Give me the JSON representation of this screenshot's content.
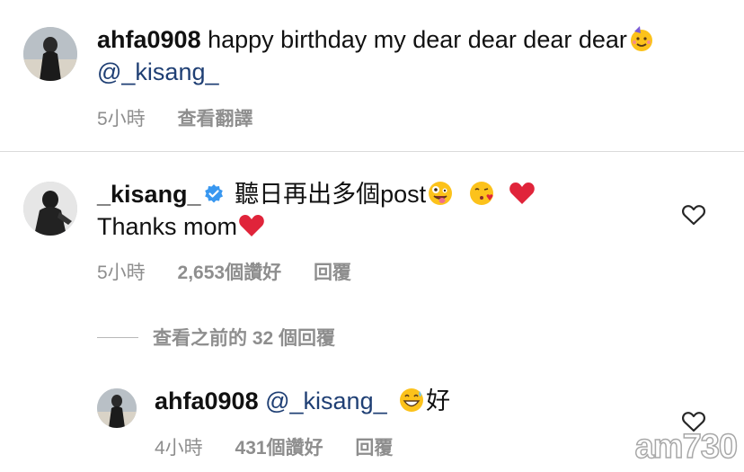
{
  "comment1": {
    "username": "ahfa0908",
    "text": "happy birthday my dear dear dear dear",
    "mention": "@_kisang_",
    "time": "5小時",
    "translate_label": "查看翻譯",
    "emoji": "partying-face"
  },
  "comment2": {
    "username": "_kisang_",
    "verified": true,
    "text_line1": "聽日再出多個post",
    "text_line2": "Thanks mom",
    "time": "5小時",
    "likes": "2,653個讚好",
    "reply_label": "回覆"
  },
  "view_replies": {
    "label": "查看之前的 32 個回覆"
  },
  "reply": {
    "username": "ahfa0908",
    "mention": "@_kisang_",
    "text": "好",
    "time": "4小時",
    "likes": "431個讚好",
    "reply_label": "回覆"
  },
  "watermark": "am730",
  "colors": {
    "mention": "#1f3f74",
    "meta": "#8e8e8e",
    "verified": "#3897f0",
    "heart": "#e0243a"
  }
}
